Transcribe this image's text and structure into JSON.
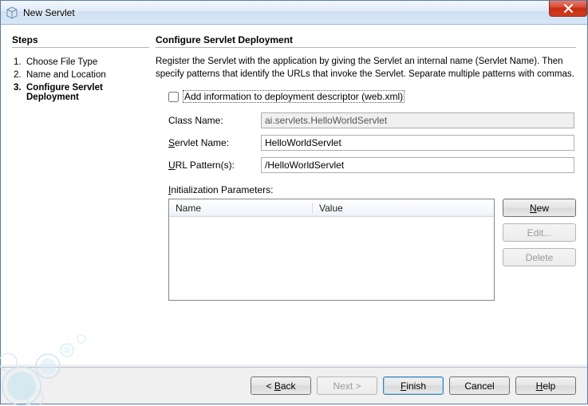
{
  "window": {
    "title": "New Servlet"
  },
  "steps": {
    "heading": "Steps",
    "items": [
      {
        "num": "1.",
        "label": "Choose File Type"
      },
      {
        "num": "2.",
        "label": "Name and Location"
      },
      {
        "num": "3.",
        "label": "Configure Servlet Deployment"
      }
    ],
    "active_index": 2
  },
  "content": {
    "heading": "Configure Servlet Deployment",
    "description": "Register the Servlet with the application by giving the Servlet an internal name (Servlet Name). Then specify patterns that identify the URLs that invoke the Servlet. Separate multiple patterns with commas.",
    "checkbox_label": "Add information to deployment descriptor (web.xml)",
    "checkbox_checked": false,
    "fields": {
      "class_name": {
        "label": "Class Name:",
        "value": "ai.servlets.HelloWorldServlet",
        "readonly": true
      },
      "servlet_name": {
        "label": "Servlet Name:",
        "value": "HelloWorldServlet"
      },
      "url_pattern": {
        "label": "URL Pattern(s):",
        "value": "/HelloWorldServlet"
      }
    },
    "params": {
      "label": "Initialization Parameters:",
      "columns": {
        "name": "Name",
        "value": "Value"
      },
      "rows": []
    },
    "side_buttons": {
      "new": "New",
      "edit": "Edit...",
      "delete": "Delete"
    }
  },
  "footer": {
    "back": "< Back",
    "next": "Next >",
    "finish": "Finish",
    "cancel": "Cancel",
    "help": "Help"
  }
}
